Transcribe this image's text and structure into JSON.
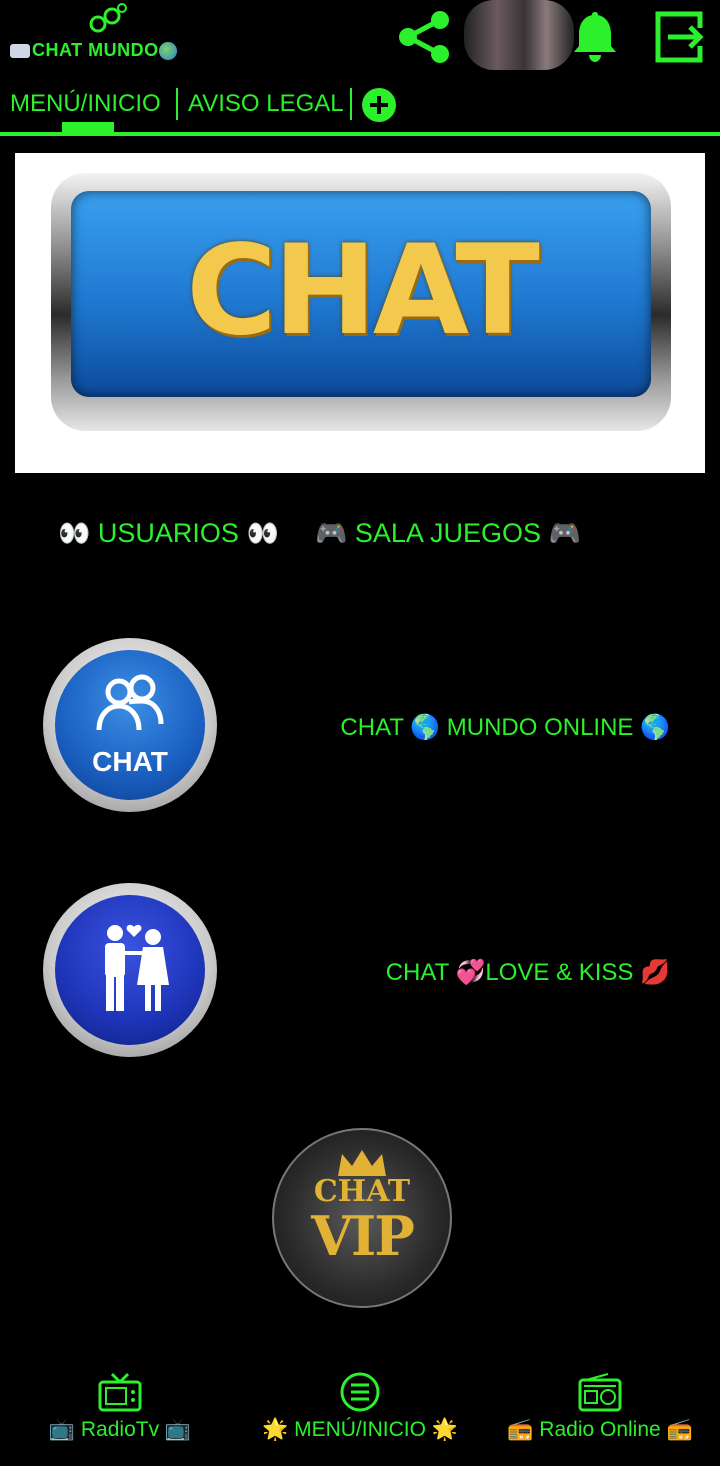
{
  "header": {
    "app_title": "CHAT MUNDO",
    "icons": [
      "share-icon",
      "bell-icon",
      "exit-icon"
    ]
  },
  "tabs": [
    {
      "label": "MENÚ/INICIO",
      "active": true
    },
    {
      "label": "AVISO LEGAL",
      "active": false
    }
  ],
  "add_tab_icon": "plus-circle-icon",
  "banner": {
    "text": "CHAT"
  },
  "links": {
    "usuarios": {
      "label": "USUARIOS",
      "emoji": "👀"
    },
    "sala_juegos": {
      "label": "SALA JUEGOS",
      "emoji": "🎮"
    }
  },
  "items": [
    {
      "button_text": "CHAT",
      "label": "CHAT 🌎 MUNDO ONLINE 🌎"
    },
    {
      "label": "CHAT 💞LOVE & KISS 💋"
    }
  ],
  "vip": {
    "small": "CHAT",
    "big": "VIP"
  },
  "bottom_nav": [
    {
      "label": "📺 RadioTv 📺",
      "icon": "tv-icon"
    },
    {
      "label": "🌟 MENÚ/INICIO 🌟",
      "icon": "menu-icon"
    },
    {
      "label": "📻 Radio Online 📻",
      "icon": "radio-icon"
    }
  ],
  "colors": {
    "accent": "#2bf02b",
    "background": "#000000"
  }
}
